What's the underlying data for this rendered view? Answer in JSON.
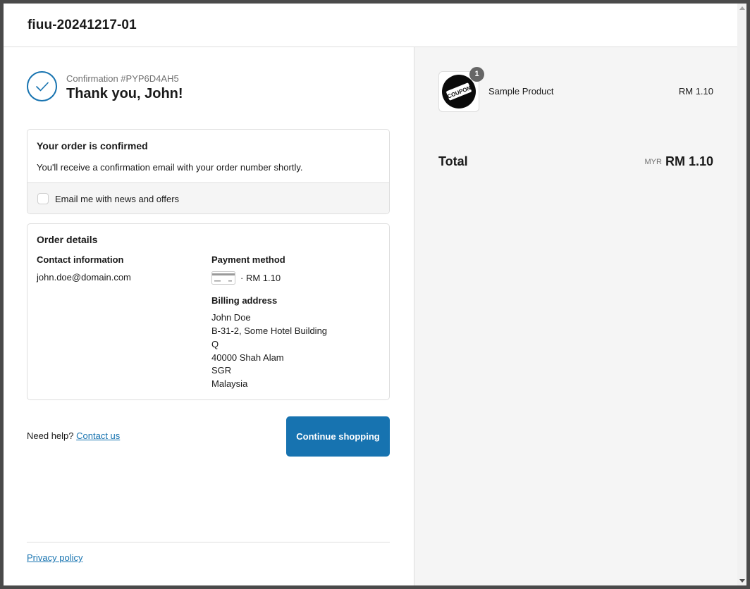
{
  "header": {
    "shop_name": "fiuu-20241217-01"
  },
  "confirmation": {
    "number": "Confirmation #PYP6D4AH5",
    "thank_you": "Thank you, John!"
  },
  "order_confirmed": {
    "title": "Your order is confirmed",
    "description": "You'll receive a confirmation email with your order number shortly.",
    "email_opt_in_label": "Email me with news and offers",
    "email_opt_in_checked": false
  },
  "order_details": {
    "title": "Order details",
    "contact": {
      "heading": "Contact information",
      "email": "john.doe@domain.com"
    },
    "payment": {
      "heading": "Payment method",
      "amount": "· RM 1.10",
      "icon": "credit-card-icon"
    },
    "billing": {
      "heading": "Billing address",
      "lines": [
        "John Doe",
        "B-31-2, Some Hotel Building",
        "Q",
        "40000 Shah Alam",
        "SGR",
        "Malaysia"
      ]
    }
  },
  "help": {
    "prefix": "Need help?",
    "link": "Contact us"
  },
  "actions": {
    "continue_label": "Continue shopping"
  },
  "footer": {
    "privacy_label": "Privacy policy"
  },
  "summary": {
    "items": [
      {
        "name": "Sample Product",
        "price": "RM 1.10",
        "quantity": "1",
        "image_label": "COUPON"
      }
    ],
    "total_label": "Total",
    "currency": "MYR",
    "total": "RM 1.10"
  },
  "colors": {
    "accent": "#1773b0",
    "sidebar_bg": "#f5f5f5",
    "border": "#dedede"
  }
}
